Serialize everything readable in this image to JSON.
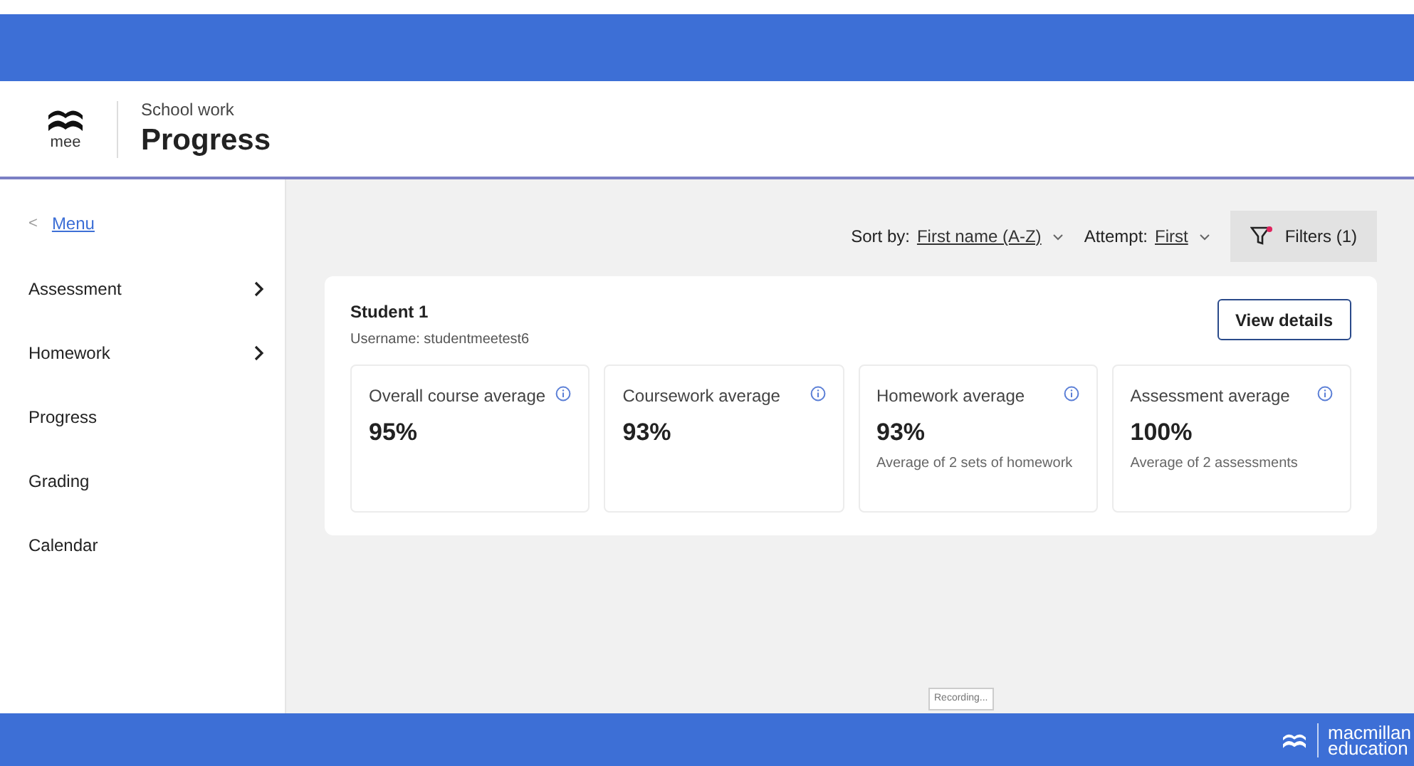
{
  "header": {
    "logo_text": "mee",
    "subtitle": "School work",
    "title": "Progress"
  },
  "sidebar": {
    "back_link": "Menu",
    "back_icon": "<",
    "items": [
      {
        "label": "Assessment",
        "has_submenu": true
      },
      {
        "label": "Homework",
        "has_submenu": true
      },
      {
        "label": "Progress",
        "has_submenu": false
      },
      {
        "label": "Grading",
        "has_submenu": false
      },
      {
        "label": "Calendar",
        "has_submenu": false
      }
    ]
  },
  "toolbar": {
    "sort_label": "Sort by:",
    "sort_value": "First name (A-Z)",
    "attempt_label": "Attempt:",
    "attempt_value": "First",
    "filters_button": "Filters (1)"
  },
  "student": {
    "name": "Student 1",
    "username_label": "Username:",
    "username": "studentmeetest6",
    "view_details_button": "View details",
    "stats": [
      {
        "title": "Overall course average",
        "value": "95%"
      },
      {
        "title": "Coursework average",
        "value": "93%"
      },
      {
        "title": "Homework average",
        "value": "93%",
        "note": "Average of 2 sets of homework"
      },
      {
        "title": "Assessment average",
        "value": "100%",
        "note": "Average of 2 assessments"
      }
    ]
  },
  "recording_tooltip": "Recording...",
  "footer": {
    "brand_line_1": "macmillan",
    "brand_line_2": "education"
  }
}
